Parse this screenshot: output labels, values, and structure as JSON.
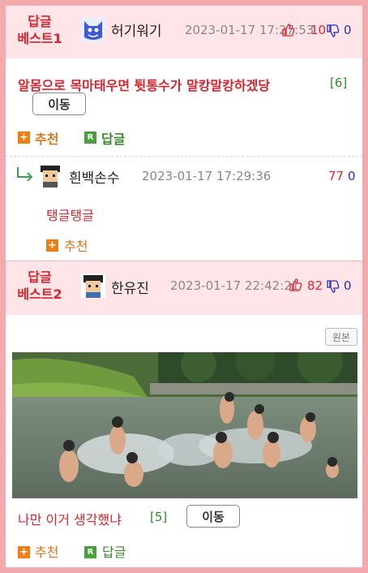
{
  "posts": [
    {
      "badge": "답글\n베스트1",
      "badge_line1": "답글",
      "badge_line2": "베스트1",
      "author": "허기워기",
      "date": "2023-01-17 17:27:53",
      "up": "10",
      "down": "0",
      "title": "알몸으로 목마태우면 튓통수가 말캉말캉하겠당",
      "reply_count": "[6]",
      "move_label": "이동",
      "recommend_label": "추천",
      "reply_label": "답글"
    },
    {
      "author": "흰백손수",
      "date": "2023-01-17 17:29:36",
      "up": "77",
      "down": "0",
      "text": "탱글탱글",
      "recommend_label": "추천"
    },
    {
      "badge_line1": "답글",
      "badge_line2": "베스트2",
      "author": "한유진",
      "date": "2023-01-17 22:42:21",
      "up": "82",
      "down": "0",
      "original_label": "원본",
      "title": "나만 이거 생각했냐",
      "reply_count": "[5]",
      "move_label": "이동",
      "recommend_label": "추천",
      "reply_label": "답글"
    }
  ],
  "colors": {
    "frame": "#f4a9ad",
    "header_bg": "#ffe5e7",
    "accent_red": "#d5272f",
    "orange": "#f07d12",
    "green": "#4aa03b",
    "blue": "#2430c8"
  }
}
